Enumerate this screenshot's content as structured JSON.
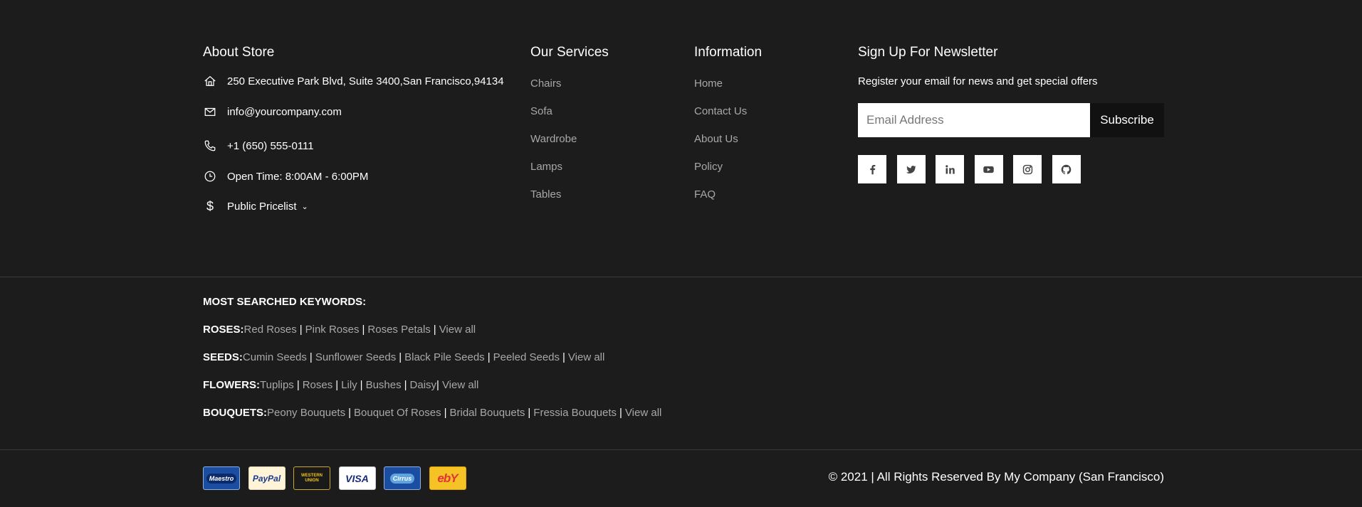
{
  "about": {
    "title": "About Store",
    "address": "250 Executive Park Blvd, Suite 3400,San Francisco,94134",
    "email": "info@yourcompany.com",
    "phone": "+1 (650) 555-0111",
    "hours": "Open Time: 8:00AM - 6:00PM",
    "pricelist": "Public Pricelist"
  },
  "services": {
    "title": "Our Services",
    "items": [
      "Chairs",
      "Sofa",
      "Wardrobe",
      "Lamps",
      "Tables"
    ]
  },
  "information": {
    "title": "Information",
    "items": [
      "Home",
      "Contact Us",
      "About Us",
      "Policy",
      "FAQ"
    ]
  },
  "newsletter": {
    "title": "Sign Up For Newsletter",
    "text": "Register your email for news and get special offers",
    "placeholder": "Email Address",
    "button": "Subscribe",
    "socials": [
      "facebook-icon",
      "twitter-icon",
      "linkedin-icon",
      "youtube-icon",
      "instagram-icon",
      "github-icon"
    ]
  },
  "keywords": {
    "title": "MOST SEARCHED KEYWORDS:",
    "groups": [
      {
        "label": "ROSES:",
        "items": [
          "Red Roses",
          "Pink Roses",
          "Roses Petals",
          "View all"
        ]
      },
      {
        "label": "SEEDS:",
        "items": [
          "Cumin Seeds",
          "Sunflower Seeds",
          "Black Pile Seeds",
          "Peeled Seeds",
          "View all"
        ]
      },
      {
        "label": "FLOWERS:",
        "items": [
          "Tuplips",
          "Roses",
          "Lily",
          "Bushes",
          "Daisy",
          "View all"
        ]
      },
      {
        "label": "BOUQUETS:",
        "items": [
          "Peony Bouquets",
          "Bouquet Of Roses",
          "Bridal Bouquets",
          "Fressia Bouquets",
          "View all"
        ]
      }
    ]
  },
  "payments": [
    "Maestro",
    "PayPal",
    "WESTERN UNION",
    "VISA",
    "Cirrus",
    "ebY"
  ],
  "copyright": "© 2021 | All Rights Reserved By My Company (San Francisco)"
}
